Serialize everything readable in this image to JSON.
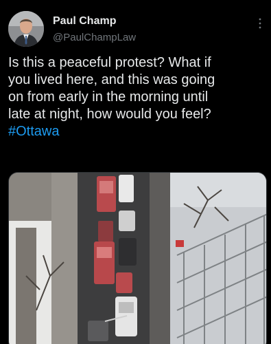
{
  "author": {
    "display_name": "Paul Champ",
    "handle": "@PaulChampLaw",
    "avatar_icon": "profile-photo"
  },
  "tweet": {
    "text": "Is this a peaceful protest? What if\nyou lived here, and this was going\non from early in the morning until\nlate at night, how would you feel?",
    "hashtag": "#Ottawa"
  },
  "menu_icon": "more-vertical-icon",
  "colors": {
    "background": "#000000",
    "text": "#e7e9ea",
    "secondary_text": "#71767b",
    "link": "#1d9bf0"
  },
  "media": {
    "type": "photo",
    "description_icon": "aerial-street-photo"
  }
}
